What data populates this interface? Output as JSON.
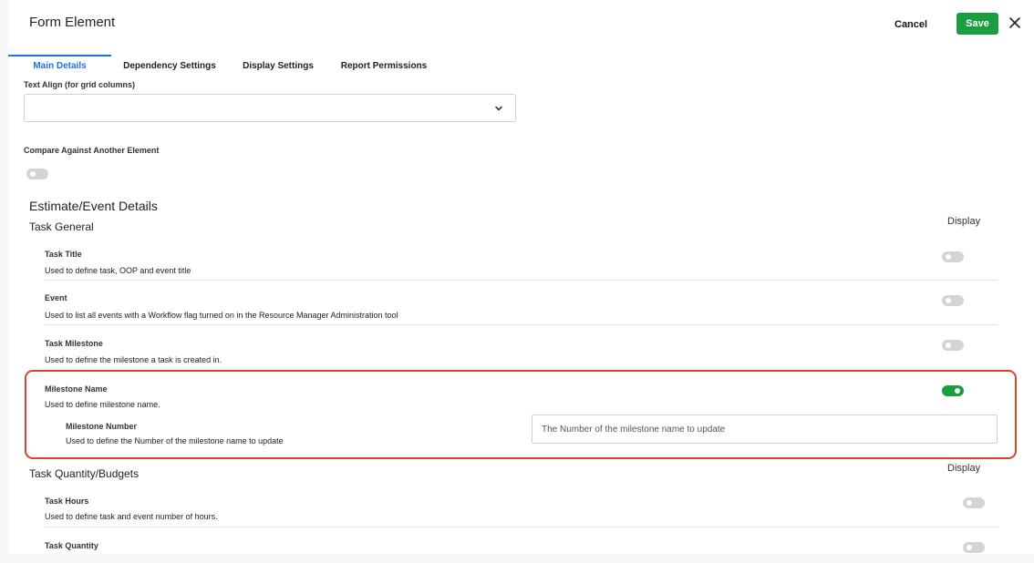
{
  "header": {
    "title": "Form Element",
    "cancel_label": "Cancel",
    "save_label": "Save"
  },
  "tabs": [
    {
      "label": "Main Details",
      "active": true
    },
    {
      "label": "Dependency Settings",
      "active": false
    },
    {
      "label": "Display Settings",
      "active": false
    },
    {
      "label": "Report Permissions",
      "active": false
    }
  ],
  "text_align": {
    "label": "Text Align (for grid columns)",
    "value": ""
  },
  "compare": {
    "label": "Compare Against Another Element",
    "enabled": false
  },
  "estimate_section": {
    "title": "Estimate/Event Details"
  },
  "task_general": {
    "title": "Task General",
    "display_label": "Display",
    "rows": [
      {
        "title": "Task Title",
        "description": "Used to define task, OOP and event title",
        "display": false
      },
      {
        "title": "Event",
        "description": "Used to list all events with a Workflow flag turned on in the Resource Manager Administration tool",
        "display": false
      },
      {
        "title": "Task Milestone",
        "description": "Used to define the milestone a task is created in.",
        "display": false
      },
      {
        "title": "Milestone Name",
        "description": "Used to define milestone name.",
        "display": true
      }
    ],
    "milestone_number": {
      "title": "Milestone Number",
      "description": "Used to define the Number of the milestone name to update",
      "placeholder": "The Number of the milestone name to update"
    }
  },
  "task_quantity": {
    "title": "Task Quantity/Budgets",
    "display_label": "Display",
    "rows": [
      {
        "title": "Task Hours",
        "description": "Used to define task and event number of hours.",
        "display": false
      },
      {
        "title": "Task Quantity",
        "description": "",
        "display": false
      }
    ]
  },
  "colors": {
    "accent": "#1a73e8",
    "save_green": "#1a9e3f",
    "highlight_red": "#d6432f"
  }
}
